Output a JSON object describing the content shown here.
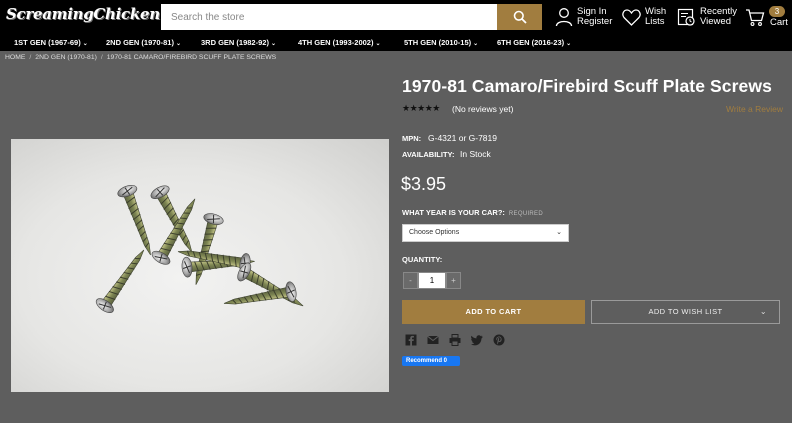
{
  "header": {
    "logo_text": "ScreamingChicken.com",
    "search_placeholder": "Search the store",
    "sign_in": "Sign In",
    "register": "Register",
    "wish_lists_1": "Wish",
    "wish_lists_2": "Lists",
    "recently_1": "Recently",
    "recently_2": "Viewed",
    "cart_label": "Cart",
    "cart_count": "3"
  },
  "nav": {
    "items": [
      {
        "label": "1ST GEN (1967-69)"
      },
      {
        "label": "2ND GEN (1970-81)"
      },
      {
        "label": "3RD GEN (1982-92)"
      },
      {
        "label": "4TH GEN (1993-2002)"
      },
      {
        "label": "5TH GEN (2010-15)"
      },
      {
        "label": "6TH GEN (2016-23)"
      }
    ]
  },
  "breadcrumb": [
    "HOME",
    "2ND GEN (1970-81)",
    "1970-81 CAMARO/FIREBIRD SCUFF PLATE SCREWS"
  ],
  "product": {
    "title": "1970-81 Camaro/Firebird Scuff Plate Screws",
    "stars": "★★★★★",
    "reviews": "(No reviews yet)",
    "write_review": "Write a Review",
    "mpn_label": "MPN:",
    "mpn_value": "G-4321 or G-7819",
    "availability_label": "AVAILABILITY:",
    "availability_value": "In Stock",
    "price": "$3.95",
    "year_label": "WHAT YEAR IS YOUR CAR?:",
    "required": "REQUIRED",
    "year_select": "Choose Options",
    "quantity_label": "QUANTITY:",
    "quantity": "1",
    "qty_dec": "-",
    "qty_inc": "+",
    "add_to_cart": "ADD TO CART",
    "add_to_wishlist": "ADD TO WISH LIST",
    "fb_recommend": "Recommend 0"
  },
  "colors": {
    "accent": "#a17d3f",
    "background": "#5e5e5e",
    "header": "#000000"
  },
  "icons": [
    "search-icon",
    "user-icon",
    "heart-icon",
    "recently-viewed-icon",
    "cart-icon",
    "facebook-icon",
    "email-icon",
    "print-icon",
    "twitter-icon",
    "pinterest-icon"
  ]
}
